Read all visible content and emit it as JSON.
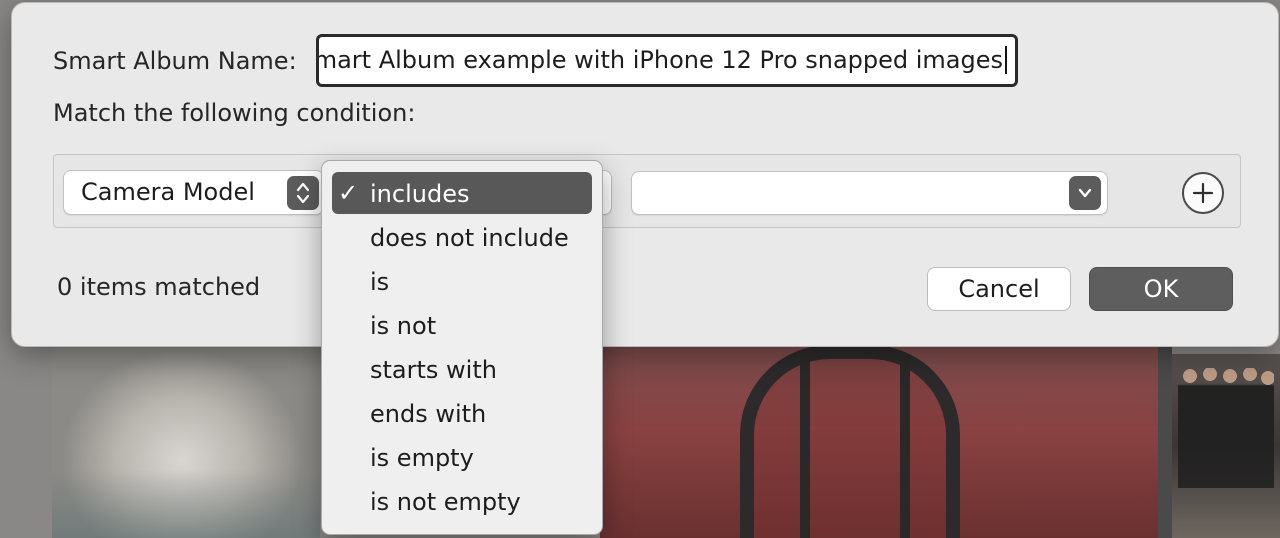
{
  "dialog": {
    "name_label": "Smart Album Name:",
    "name_value": "mart Album example with iPhone 12 Pro snapped images",
    "condition_label": "Match the following condition:",
    "field_popup": "Camera Model",
    "value_popup": "",
    "matched_text": "0 items matched",
    "cancel_label": "Cancel",
    "ok_label": "OK"
  },
  "menu": {
    "check": "✓",
    "items": [
      "includes",
      "does not include",
      "is",
      "is not",
      "starts with",
      "ends with",
      "is empty",
      "is not empty"
    ],
    "selected_index": 0
  },
  "icons": {
    "field_stepper": "up-down-chevron-icon",
    "value_stepper": "chevron-down-icon",
    "add": "plus-icon"
  },
  "colors": {
    "selection": "#585858",
    "dialog_bg": "#e9e9e9",
    "ok_button": "#5e5e5e"
  }
}
